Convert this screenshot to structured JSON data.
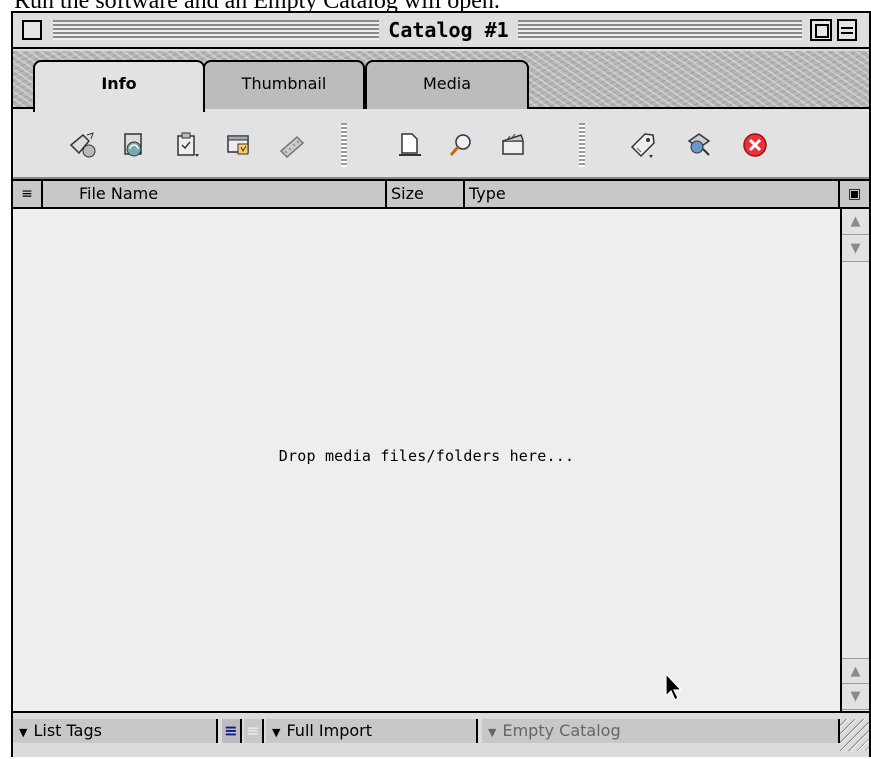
{
  "caption": "Run the software and an Empty Catalog will open.",
  "window": {
    "title": "Catalog #1"
  },
  "tabs": [
    {
      "label": "Info",
      "active": true
    },
    {
      "label": "Thumbnail",
      "active": false
    },
    {
      "label": "Media",
      "active": false
    }
  ],
  "toolbar": {
    "groups": [
      [
        "add-item-icon",
        "refresh-icon",
        "clipboard-icon",
        "properties-icon",
        "filmstrip-icon"
      ],
      [
        "new-document-icon",
        "magnifier-icon",
        "clapper-icon"
      ],
      [
        "tag-icon",
        "globe-icon",
        "delete-icon"
      ]
    ],
    "accent": "#e8333a"
  },
  "columns": {
    "sort_glyph": "≡",
    "file_name": "File Name",
    "size": "Size",
    "type": "Type",
    "menu_glyph": "▣"
  },
  "list": {
    "empty_hint": "Drop media files/folders here..."
  },
  "statusbar": {
    "list_tags": "List Tags",
    "import_mode": "Full Import",
    "catalog_status": "Empty Catalog",
    "list_view_glyph": "≡",
    "thumb_view_glyph": "≡"
  }
}
